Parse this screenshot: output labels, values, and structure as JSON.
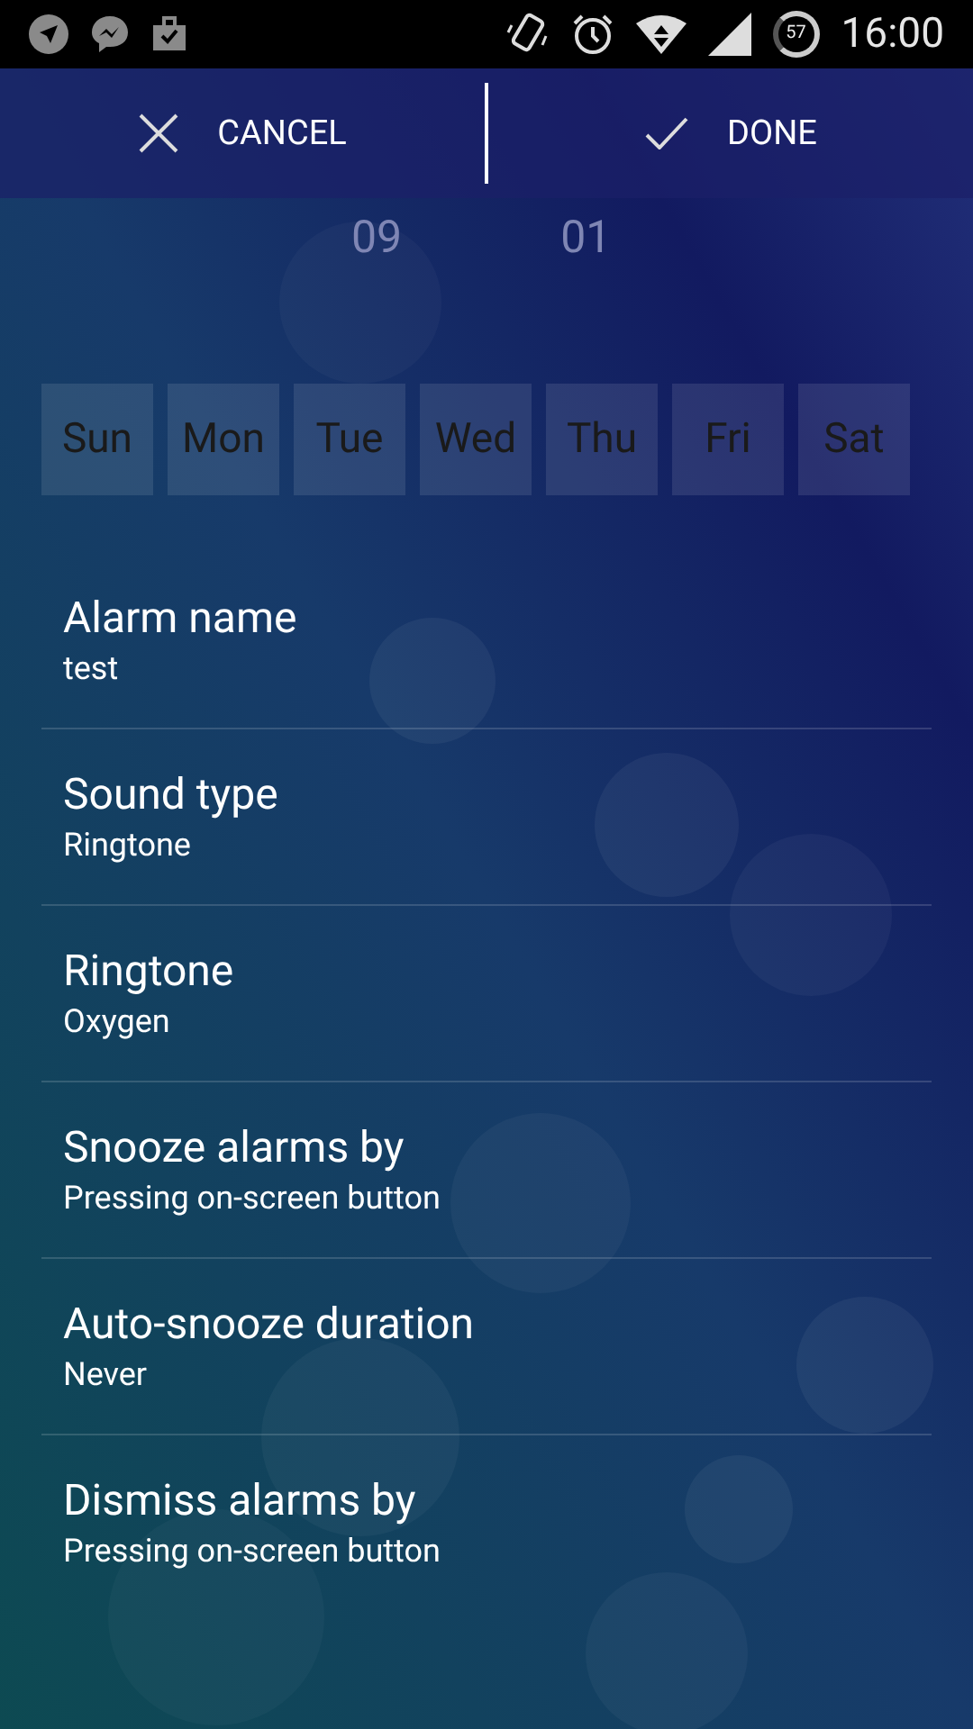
{
  "status_bar": {
    "battery": "57",
    "time": "16:00"
  },
  "action_bar": {
    "cancel": "CANCEL",
    "done": "DONE"
  },
  "time_picker": {
    "hour": "09",
    "minute": "01"
  },
  "days": [
    {
      "label": "Sun",
      "selected": false
    },
    {
      "label": "Mon",
      "selected": false
    },
    {
      "label": "Tue",
      "selected": false
    },
    {
      "label": "Wed",
      "selected": false
    },
    {
      "label": "Thu",
      "selected": false
    },
    {
      "label": "Fri",
      "selected": false
    },
    {
      "label": "Sat",
      "selected": false
    }
  ],
  "settings": [
    {
      "title": "Alarm name",
      "value": "test"
    },
    {
      "title": "Sound type",
      "value": "Ringtone"
    },
    {
      "title": "Ringtone",
      "value": "Oxygen"
    },
    {
      "title": "Snooze alarms by",
      "value": "Pressing on-screen button"
    },
    {
      "title": "Auto-snooze duration",
      "value": "Never"
    },
    {
      "title": "Dismiss alarms by",
      "value": "Pressing on-screen button"
    }
  ]
}
